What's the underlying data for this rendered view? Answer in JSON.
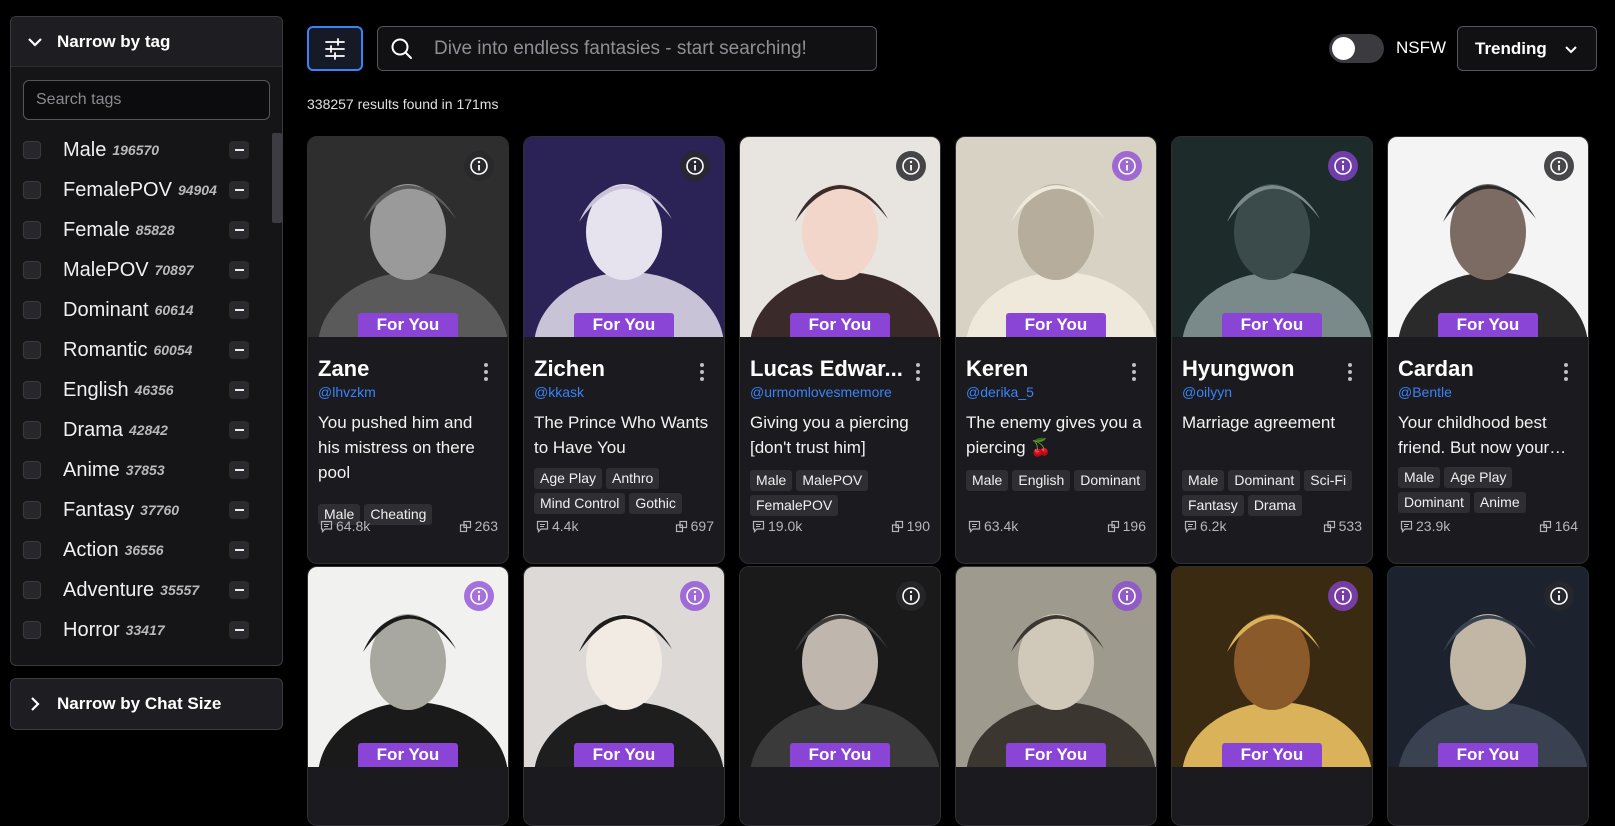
{
  "sidebar": {
    "tag_panel_title": "Narrow by tag",
    "tag_search_placeholder": "Search tags",
    "tags": [
      {
        "name": "Male",
        "count": "196570"
      },
      {
        "name": "FemalePOV",
        "count": "94904"
      },
      {
        "name": "Female",
        "count": "85828"
      },
      {
        "name": "MalePOV",
        "count": "70897"
      },
      {
        "name": "Dominant",
        "count": "60614"
      },
      {
        "name": "Romantic",
        "count": "60054"
      },
      {
        "name": "English",
        "count": "46356"
      },
      {
        "name": "Drama",
        "count": "42842"
      },
      {
        "name": "Anime",
        "count": "37853"
      },
      {
        "name": "Fantasy",
        "count": "37760"
      },
      {
        "name": "Action",
        "count": "36556"
      },
      {
        "name": "Adventure",
        "count": "35557"
      },
      {
        "name": "Horror",
        "count": "33417"
      }
    ],
    "chat_size_title": "Narrow by Chat Size"
  },
  "search": {
    "placeholder": "Dive into endless fantasies - start searching!",
    "nsfw_label": "NSFW",
    "nsfw_enabled": false,
    "sort_value": "Trending"
  },
  "results_text": "338257 results found in 171ms",
  "badge_label": "For You",
  "colors": {
    "accent": "#8b45d6",
    "link": "#3b82f6",
    "bg": "#000000"
  },
  "cards": [
    {
      "name": "Zane",
      "handle": "@lhvzkm",
      "desc": "You pushed him and his mistress on there pool",
      "tags": [
        "Male",
        "Cheating"
      ],
      "chats": "64.8k",
      "likes": "263",
      "info_purple": false
    },
    {
      "name": "Zichen",
      "handle": "@kkask",
      "desc": "The Prince Who Wants to Have You",
      "tags": [
        "Age Play",
        "Anthro",
        "Mind Control",
        "Gothic"
      ],
      "chats": "4.4k",
      "likes": "697",
      "info_purple": false
    },
    {
      "name": "Lucas Edwar...",
      "handle": "@urmomlovesmemore",
      "desc": "Giving you a piercing [don't trust him]",
      "tags": [
        "Male",
        "MalePOV",
        "FemalePOV"
      ],
      "chats": "19.0k",
      "likes": "190",
      "info_purple": false
    },
    {
      "name": "Keren",
      "handle": "@derika_5",
      "desc": "The enemy gives you a piercing 🍒",
      "tags": [
        "Male",
        "English",
        "Dominant"
      ],
      "chats": "63.4k",
      "likes": "196",
      "info_purple": true
    },
    {
      "name": "Hyungwon",
      "handle": "@oilyyn",
      "desc": "Marriage agreement",
      "tags": [
        "Male",
        "Dominant",
        "Sci-Fi",
        "Fantasy",
        "Drama"
      ],
      "chats": "6.2k",
      "likes": "533",
      "info_purple": true
    },
    {
      "name": "Cardan",
      "handle": "@Bentle",
      "desc": "Your childhood best friend. But now your…",
      "tags": [
        "Male",
        "Age Play",
        "Dominant",
        "Anime"
      ],
      "chats": "23.9k",
      "likes": "164",
      "info_purple": false
    }
  ],
  "row2_info_purple": [
    true,
    true,
    false,
    true,
    true,
    false
  ]
}
